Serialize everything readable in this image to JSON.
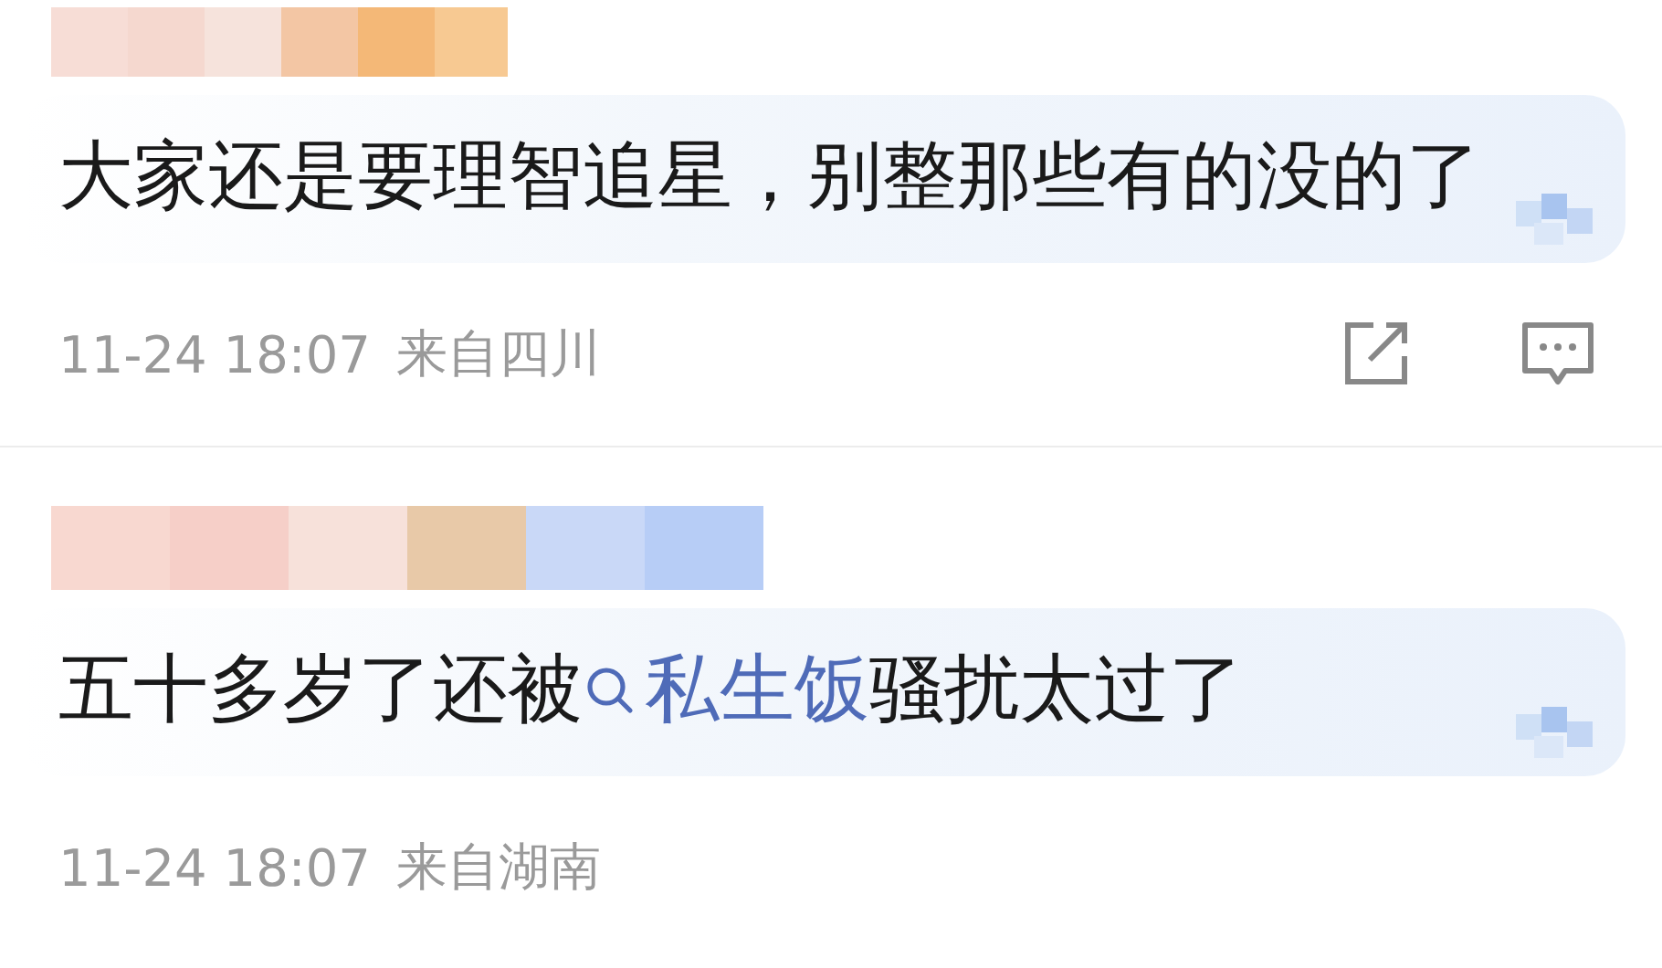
{
  "comments": [
    {
      "parts": [
        {
          "kind": "plain",
          "text": "大家还是要理智追星，别整那些有的没的了"
        }
      ],
      "time": "11-24 18:07",
      "location": "来自四川",
      "show_actions": true
    },
    {
      "parts": [
        {
          "kind": "plain",
          "text": "五十多岁了还被"
        },
        {
          "kind": "search_link",
          "text": "私生饭"
        },
        {
          "kind": "plain",
          "text": "骚扰太过了"
        }
      ],
      "time": "11-24 18:07",
      "location": "来自湖南",
      "show_actions": false
    }
  ]
}
